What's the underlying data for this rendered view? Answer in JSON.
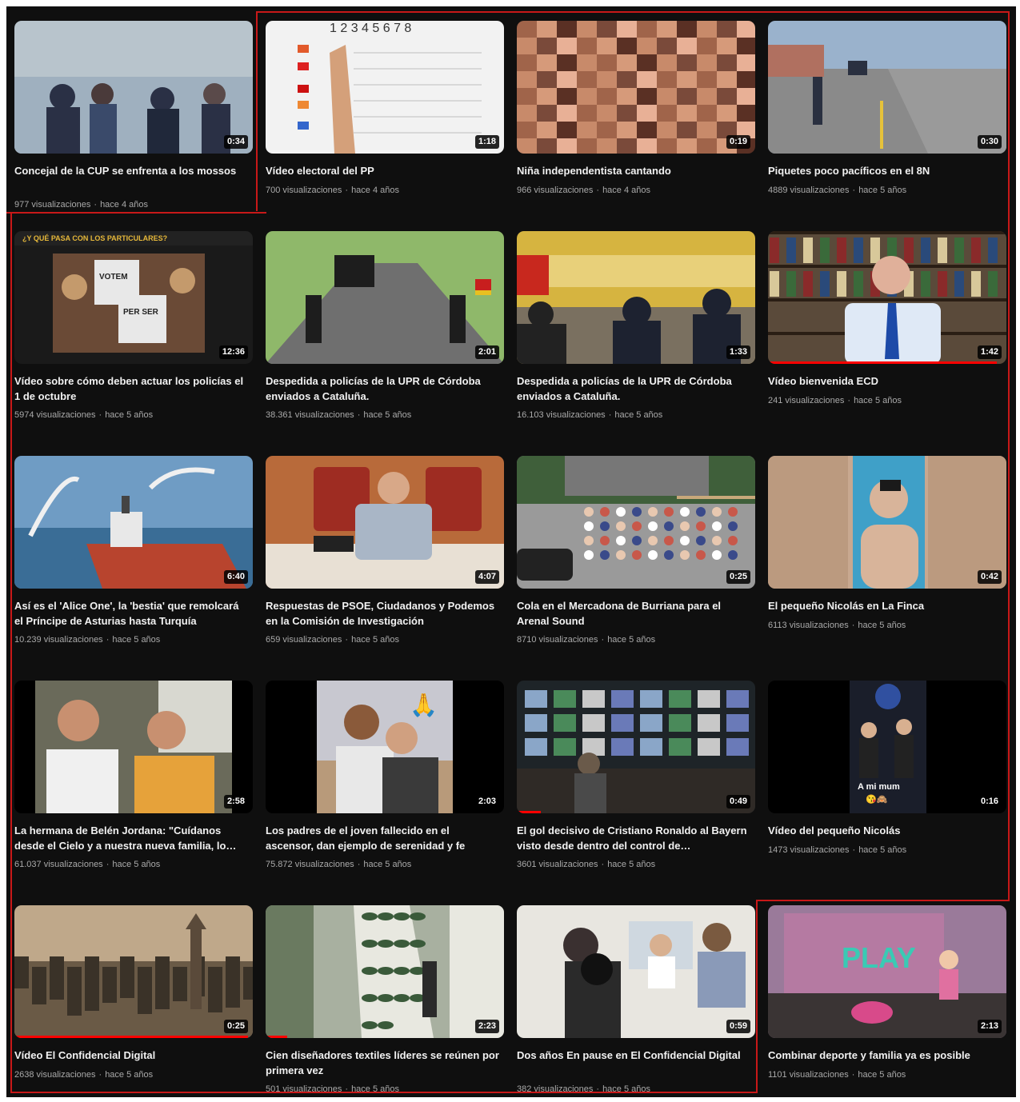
{
  "colors": {
    "page_bg": "#0f0f0f",
    "title": "#f1f1f1",
    "meta": "#aaaaaa",
    "progress": "#ff0000",
    "annotation": "#c81818"
  },
  "separator": "·",
  "videos": [
    {
      "title": "Concejal de la CUP se enfrenta a los mossos",
      "views": "977 visualizaciones",
      "age": "hace 4 años",
      "duration": "0:34",
      "scene": "protest",
      "thumb_colors": [
        "#9fb0bf",
        "#2a3045",
        "#b8c4cc"
      ]
    },
    {
      "title": "Vídeo electoral del PP",
      "views": "700 visualizaciones",
      "age": "hace 4 años",
      "duration": "1:18",
      "scene": "whiteboard",
      "thumb_colors": [
        "#f2f2f2",
        "#e25a2b",
        "#d4a07a"
      ]
    },
    {
      "title": "Niña independentista cantando",
      "views": "966 visualizaciones",
      "age": "hace 4 años",
      "duration": "0:19",
      "scene": "pixelated",
      "thumb_colors": [
        "#a0644a",
        "#d69a7a",
        "#5a3024"
      ]
    },
    {
      "title": "Piquetes poco pacíficos en el 8N",
      "views": "4889 visualizaciones",
      "age": "hace 5 años",
      "duration": "0:30",
      "scene": "street",
      "thumb_colors": [
        "#9ab2cc",
        "#8a8a8a",
        "#2a3040"
      ]
    },
    {
      "title": "Vídeo sobre cómo deben actuar los policías el 1 de octubre",
      "views": "5974 visualizaciones",
      "age": "hace 5 años",
      "duration": "12:36",
      "scene": "protest_signs",
      "banner": "¿Y QUÉ PASA CON LOS PARTICULARES?",
      "sign_text": "VOTEM PER SER LLIURES",
      "thumb_colors": [
        "#1a1a1a",
        "#e8e8e8",
        "#c49a6c"
      ]
    },
    {
      "title": "Despedida a policías de la UPR de Córdoba enviados a Cataluña.",
      "views": "38.361 visualizaciones",
      "age": "hace 5 años",
      "duration": "2:01",
      "scene": "road_bikes",
      "thumb_colors": [
        "#8fb86a",
        "#6f6f6f",
        "#1d1d1d"
      ]
    },
    {
      "title": "Despedida a policías de la UPR de Córdoba enviados a Cataluña.",
      "views": "16.103 visualizaciones",
      "age": "hace 5 años",
      "duration": "1:33",
      "scene": "square_police",
      "thumb_colors": [
        "#d6b440",
        "#c8281e",
        "#1d2230"
      ]
    },
    {
      "title": "Vídeo bienvenida ECD",
      "views": "241 visualizaciones",
      "age": "hace 5 años",
      "duration": "1:42",
      "scene": "bookshelf_man",
      "progress": 0.96,
      "thumb_colors": [
        "#5a4a3a",
        "#dfe9f6",
        "#1d4aa8"
      ]
    },
    {
      "title": "Así es el 'Alice One', la 'bestia' que remolcará el Príncipe de Asturias hasta Turquía",
      "views": "10.239 visualizaciones",
      "age": "hace 5 años",
      "duration": "6:40",
      "scene": "ship",
      "thumb_colors": [
        "#6f9cc4",
        "#3a6d96",
        "#b8442e"
      ]
    },
    {
      "title": "Respuestas de PSOE, Ciudadanos y Podemos en la Comisión de Investigación",
      "views": "659 visualizaciones",
      "age": "hace 5 años",
      "duration": "4:07",
      "scene": "committee",
      "thumb_colors": [
        "#b86a3a",
        "#9e2c22",
        "#a9b6c6"
      ]
    },
    {
      "title": "Cola en el Mercadona de Burriana para el Arenal Sound",
      "views": "8710 visualizaciones",
      "age": "hace 5 años",
      "duration": "0:25",
      "scene": "crowd",
      "thumb_colors": [
        "#9a9a9a",
        "#3f5f3a",
        "#c8584a"
      ]
    },
    {
      "title": "El pequeño Nicolás en La Finca",
      "views": "6113 visualizaciones",
      "age": "hace 5 años",
      "duration": "0:42",
      "scene": "selfie",
      "thumb_colors": [
        "#c8a890",
        "#3fa0c8",
        "#d8b49a"
      ]
    },
    {
      "title": "La hermana de Belén Jordana: \"Cuídanos desde el Cielo y a nuestra nueva familia, lo…",
      "views": "61.037 visualizaciones",
      "age": "hace 5 años",
      "duration": "2:58",
      "scene": "couple_train",
      "thumb_colors": [
        "#6a6a5a",
        "#e6a23a",
        "#f0f0f0"
      ]
    },
    {
      "title": "Los padres de el joven fallecido en el ascensor, dan ejemplo de serenidad y fe",
      "views": "75.872 visualizaciones",
      "age": "hace 5 años",
      "duration": "2:03",
      "scene": "couple_outdoor",
      "emoji": "🙏",
      "thumb_colors": [
        "#c8c8d0",
        "#8a5a3a",
        "#e8e8e8"
      ]
    },
    {
      "title": "El gol decisivo de Cristiano Ronaldo al Bayern visto desde dentro del control de…",
      "views": "3601 visualizaciones",
      "age": "hace 5 años",
      "duration": "0:49",
      "scene": "control_room",
      "progress": 0.1,
      "thumb_colors": [
        "#1e2428",
        "#8a9aaa",
        "#2f2a26"
      ]
    },
    {
      "title": "Vídeo del pequeño Nicolás",
      "views": "1473 visualizaciones",
      "age": "hace 5 años",
      "duration": "0:16",
      "scene": "concert",
      "story_text": "A mi mum",
      "thumb_colors": [
        "#1a1e2a",
        "#3050a0",
        "#c0c0c0"
      ]
    },
    {
      "title": "Vídeo El Confidencial Digital",
      "views": "2638 visualizaciones",
      "age": "hace 5 años",
      "duration": "0:25",
      "scene": "city",
      "progress": 0.98,
      "thumb_colors": [
        "#bfa88a",
        "#6a5a46",
        "#3a3228"
      ]
    },
    {
      "title": "Cien diseñadores textiles líderes se reúnen por primera vez",
      "views": "501 visualizaciones",
      "age": "hace 5 años",
      "duration": "2:23",
      "scene": "fabric",
      "progress": 0.09,
      "thumb_colors": [
        "#a8b0a0",
        "#3a5a3a",
        "#e8e8e0"
      ]
    },
    {
      "title": "Dos años En pause en El Confidencial Digital",
      "views": "382 visualizaciones",
      "age": "hace 5 años",
      "duration": "0:59",
      "scene": "office",
      "thumb_colors": [
        "#e8e6e0",
        "#2a2a2a",
        "#8a9ab8"
      ]
    },
    {
      "title": "Combinar deporte y familia ya es posible",
      "views": "1101 visualizaciones",
      "age": "hace 5 años",
      "duration": "2:13",
      "scene": "play",
      "sign_text": "PLAY",
      "thumb_colors": [
        "#9a7a9a",
        "#3acab4",
        "#e070a0"
      ]
    }
  ]
}
